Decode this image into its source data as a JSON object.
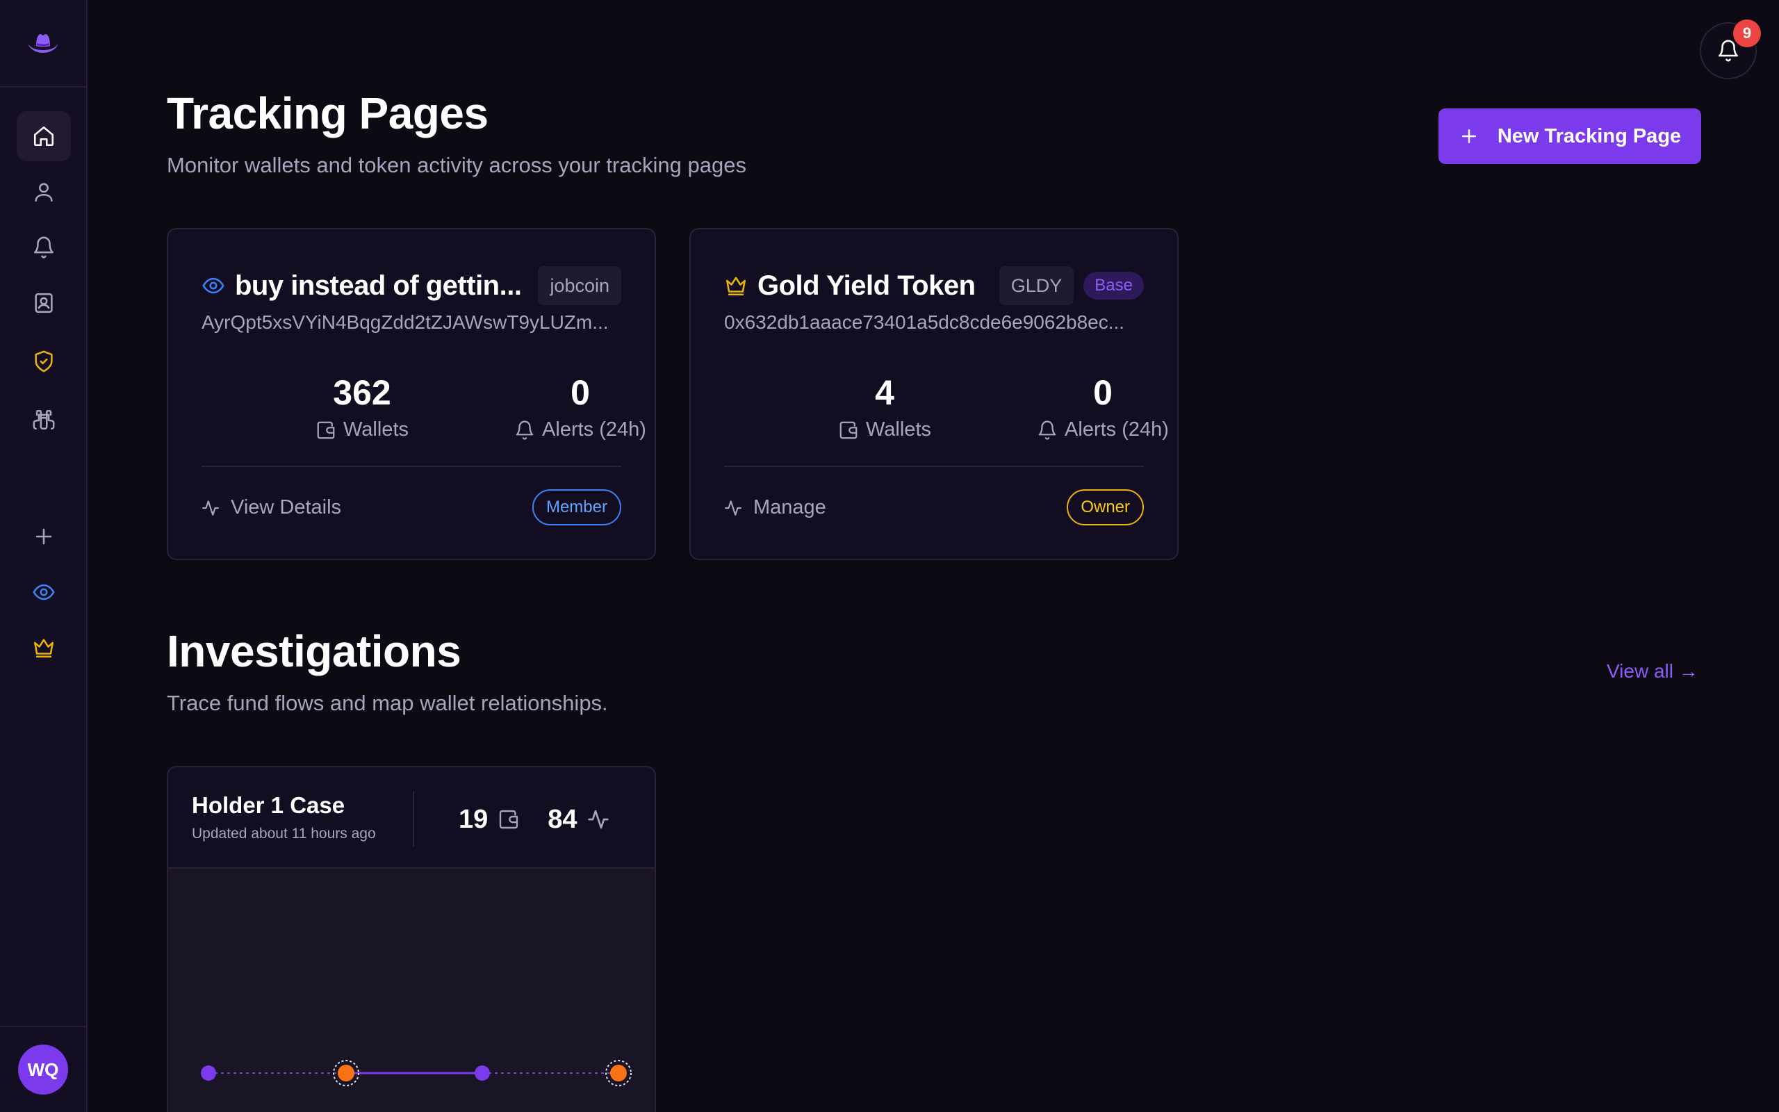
{
  "header": {
    "notification_count": "9"
  },
  "user": {
    "initials": "WQ"
  },
  "tracking": {
    "title": "Tracking Pages",
    "subtitle": "Monitor wallets and token activity across your tracking pages",
    "new_button_label": "New Tracking Page",
    "cards": [
      {
        "icon": "eye-icon",
        "name": "buy instead of gettin...",
        "chip": "jobcoin",
        "address": "AyrQpt5xsVYiN4BqgZdd2tZJAWswT9yLUZm...",
        "wallets": "362",
        "wallets_label": "Wallets",
        "alerts": "0",
        "alerts_label": "Alerts (24h)",
        "action_label": "View Details",
        "role": "Member"
      },
      {
        "icon": "crown-icon",
        "name": "Gold Yield Token",
        "chip": "GLDY",
        "network": "Base",
        "address": "0x632db1aaace73401a5dc8cde6e9062b8ec...",
        "wallets": "4",
        "wallets_label": "Wallets",
        "alerts": "0",
        "alerts_label": "Alerts (24h)",
        "action_label": "Manage",
        "role": "Owner"
      }
    ]
  },
  "investigations": {
    "title": "Investigations",
    "subtitle": "Trace fund flows and map wallet relationships.",
    "view_all_label": "View all →",
    "cases": [
      {
        "name": "Holder 1 Case",
        "updated": "Updated about 11 hours ago",
        "wallets": "19",
        "activity": "84"
      }
    ]
  },
  "colors": {
    "accent": "#7c3aed",
    "member": "#3b82f6",
    "owner": "#eab308",
    "node_orange": "#f97316",
    "badge_red": "#ef4444"
  },
  "sidebar": {
    "items": [
      {
        "icon": "home-icon",
        "active": true
      },
      {
        "icon": "user-icon"
      },
      {
        "icon": "bell-icon"
      },
      {
        "icon": "contact-book-icon"
      },
      {
        "icon": "shield-check-icon"
      },
      {
        "icon": "binoculars-icon"
      },
      {
        "icon": "plus-icon"
      },
      {
        "icon": "eye-icon"
      },
      {
        "icon": "crown-icon"
      }
    ]
  }
}
